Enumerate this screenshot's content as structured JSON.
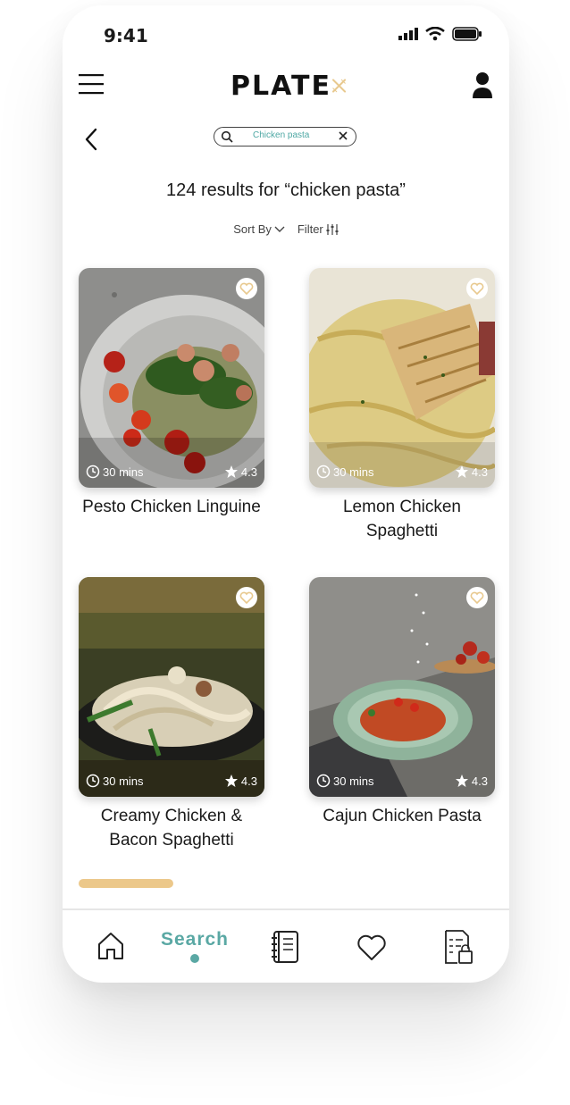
{
  "status_bar": {
    "time": "9:41"
  },
  "header": {
    "logo_text": "PLATE",
    "logo_icon": "fork-knife-icon"
  },
  "search": {
    "query": "Chicken pasta"
  },
  "results": {
    "title": "124 results for “chicken pasta”"
  },
  "controls": {
    "sort_label": "Sort By",
    "filter_label": "Filter"
  },
  "recipes": [
    {
      "title": "Pesto Chicken Linguine",
      "time": "30 mins",
      "rating": "4.3"
    },
    {
      "title": "Lemon Chicken Spaghetti",
      "time": "30 mins",
      "rating": "4.3"
    },
    {
      "title": "Creamy Chicken & Bacon Spaghetti",
      "time": "30 mins",
      "rating": "4.3"
    },
    {
      "title": "Cajun Chicken Pasta",
      "time": "30 mins",
      "rating": "4.3"
    }
  ],
  "nav": {
    "active_label": "Search"
  },
  "colors": {
    "accent": "#5aa8a4",
    "logo_gold": "#e8c98f",
    "progress": "#ecc88a"
  }
}
